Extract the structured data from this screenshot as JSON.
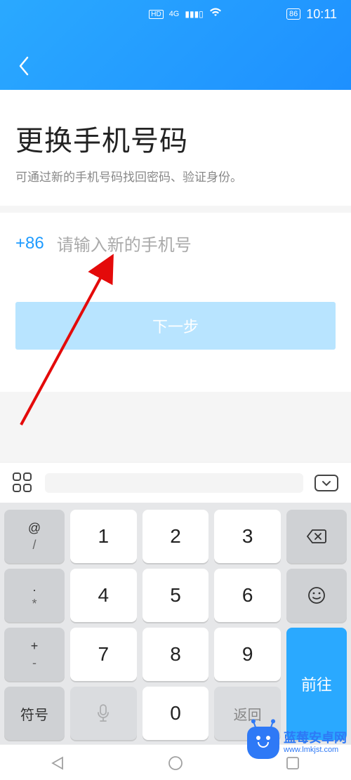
{
  "status": {
    "hd": "HD",
    "network": "4G",
    "battery_pct": "86",
    "time": "10:11"
  },
  "page": {
    "title": "更换手机号码",
    "subtitle": "可通过新的手机号码找回密码、验证身份。"
  },
  "phone": {
    "country_code": "+86",
    "placeholder": "请输入新的手机号",
    "next_button": "下一步"
  },
  "keyboard": {
    "side_left": [
      {
        "top": "@",
        "bottom": "/"
      },
      {
        "top": ".",
        "bottom": "*"
      },
      {
        "top": "+",
        "bottom": "-"
      }
    ],
    "symbol_key": "符号",
    "numbers": [
      "1",
      "2",
      "3",
      "4",
      "5",
      "6",
      "7",
      "8",
      "9",
      "0"
    ],
    "return_key": "返回",
    "go_key": "前往"
  },
  "watermark": {
    "name": "蓝莓安卓网",
    "url": "www.lmkjst.com"
  }
}
